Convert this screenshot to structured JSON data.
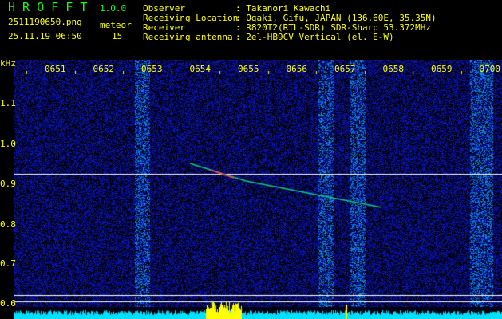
{
  "app": {
    "name": "H R O F F T",
    "version": "1.0.0"
  },
  "file": {
    "filename": "2511190650.png",
    "datetime": "25.11.19 06:50",
    "meteor_label": "meteor",
    "meteor_count": "15"
  },
  "info": [
    {
      "label": "Observer",
      "value": ": Takanori Kawachi"
    },
    {
      "label": "Receiving Location",
      "value": ": Ogaki, Gifu, JAPAN (136.60E, 35.35N)"
    },
    {
      "label": "Receiver",
      "value": ": R820T2(RTL-SDR) SDR-Sharp 53.372MHz"
    },
    {
      "label": "Receiving antenna",
      "value": ": 2el-HB9CV Vertical (el. E-W)"
    }
  ],
  "axis": {
    "unit": "kHz",
    "time_labels": [
      "0651",
      "0652",
      "0653",
      "0654",
      "0655",
      "0656",
      "0657",
      "0658",
      "0659",
      "0700"
    ],
    "freq_labels": [
      "1.1",
      "1.0",
      "0.9",
      "0.8",
      "0.7",
      "0.6"
    ]
  },
  "colors": {
    "background": "#000000",
    "text": "#ffff00",
    "title": "#11ff11",
    "noise": "#1010a0",
    "spectrum": "#00e0ff"
  }
}
